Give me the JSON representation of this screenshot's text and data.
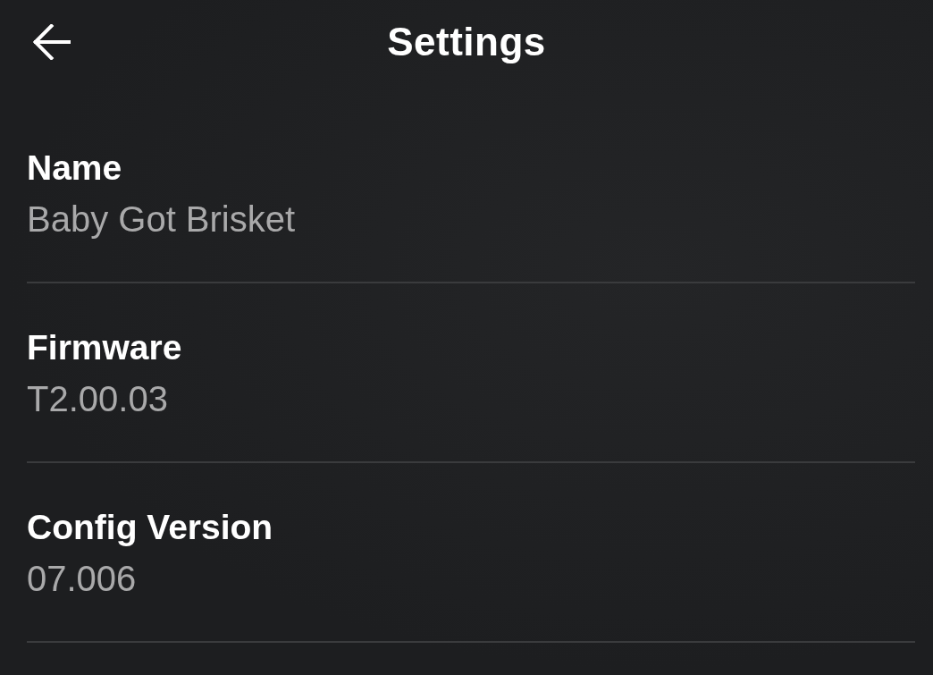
{
  "header": {
    "title": "Settings"
  },
  "settings": [
    {
      "label": "Name",
      "value": "Baby Got Brisket"
    },
    {
      "label": "Firmware",
      "value": "T2.00.03"
    },
    {
      "label": "Config Version",
      "value": "07.006"
    }
  ]
}
